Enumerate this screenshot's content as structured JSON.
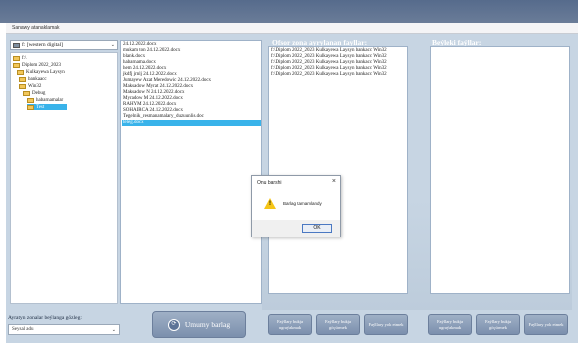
{
  "window": {
    "title": "Sanawy atanaklamak"
  },
  "drive": {
    "label": "f: [western digital]"
  },
  "tree": {
    "items": [
      {
        "label": "f:\\",
        "level": 0
      },
      {
        "label": "Diplom 2022_2023",
        "level": 0
      },
      {
        "label": "Kulkayewa Laysyn",
        "level": 1
      },
      {
        "label": "bankaacc",
        "level": 1
      },
      {
        "label": "Win32",
        "level": 1
      },
      {
        "label": "Debug",
        "level": 2
      },
      {
        "label": "habarnamalar",
        "level": 3
      },
      {
        "label": "Test",
        "level": 3,
        "selected": true
      }
    ]
  },
  "files": {
    "items": [
      "24.12.2022.docx",
      "mukam ton 24.12.2022.docx",
      "blank.docx",
      "habarnama.docx",
      "hem 24.12.2022.docx",
      "jkdfj jrnlj 24.12.2022.docx",
      "Jumayew Azat Meredowic 24.12.2022.docx",
      "Maksadow Myrat 24.12.2022.docx",
      "Maksadow N 24.12.2022.docx",
      "Myradow M 24.12.2022.docx",
      "RAHYM 24.12.2022.docx",
      "SOHAIRCA 24.12.2022.docx",
      "Tegelnik_resmanamalary_duzuunlis.doc",
      "teleg.docx"
    ],
    "selected_index": 13
  },
  "offsite": {
    "header": "Ofsor zona ayrylanan fayllar:",
    "items": [
      "f:\\Diplom 2022_2023 Kulkayewa Laysyn bankacc Win32",
      "f:\\Diplom 2022_2023 Kulkayewa Laysyn bankacc Win32",
      "f:\\Diplom 2022_2023 Kulkayewa Laysyn bankacc Win32",
      "f:\\Diplom 2022_2023 Kulkayewa Laysyn bankacc Win32",
      "f:\\Diplom 2022_2023 Kulkayewa Laysyn bankacc Win32"
    ]
  },
  "other": {
    "header": "Beýleki faýllar:",
    "items": []
  },
  "search": {
    "label": "Ayratyn zonalar beýlanga gözleg:",
    "value": "Seysal adu"
  },
  "buttons": {
    "main": "Umumy barlag",
    "offsite": [
      "Faýllary bukja ugraýakmak",
      "Faýllary bukja göçürmek",
      "Faýllary yok etmek"
    ],
    "other": [
      "Faýllary bukja ugraýakmak",
      "Faýllary bukja göçürmek",
      "Faýllary yok etmek"
    ]
  },
  "dialog": {
    "title": "Onu barshi",
    "message": "Barlag tamamlandy",
    "ok": "OK"
  },
  "colors": {
    "app_bg": "#c7d5e3",
    "selection": "#39b3ea",
    "button": "#7b8fad",
    "warning": "#f5c518"
  }
}
